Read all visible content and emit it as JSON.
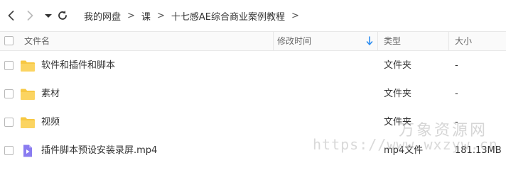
{
  "breadcrumb": {
    "items": [
      "我的网盘",
      "课",
      "十七感AE综合商业案例教程"
    ],
    "separator": ">"
  },
  "columns": {
    "name": "文件名",
    "modified": "修改时间",
    "type": "类型",
    "size": "大小"
  },
  "sort": {
    "column": "modified",
    "direction": "descending"
  },
  "files": [
    {
      "name": "软件和插件和脚本",
      "modified": "",
      "type": "文件夹",
      "size": "-",
      "icon": "folder-icon"
    },
    {
      "name": "素材",
      "modified": "",
      "type": "文件夹",
      "size": "-",
      "icon": "folder-icon"
    },
    {
      "name": "视频",
      "modified": "",
      "type": "文件夹",
      "size": "-",
      "icon": "folder-icon"
    },
    {
      "name": "插件脚本预设安装录屏.mp4",
      "modified": "",
      "type": "mp4文件",
      "size": "181.13MB",
      "icon": "video-file-icon"
    }
  ],
  "watermark": {
    "text": "万象资源网",
    "url": "https://www.wxzyw.cn"
  },
  "colors": {
    "folder": "#f7c843",
    "video": "#8a7cf0",
    "sort_arrow": "#2f8ef0"
  }
}
